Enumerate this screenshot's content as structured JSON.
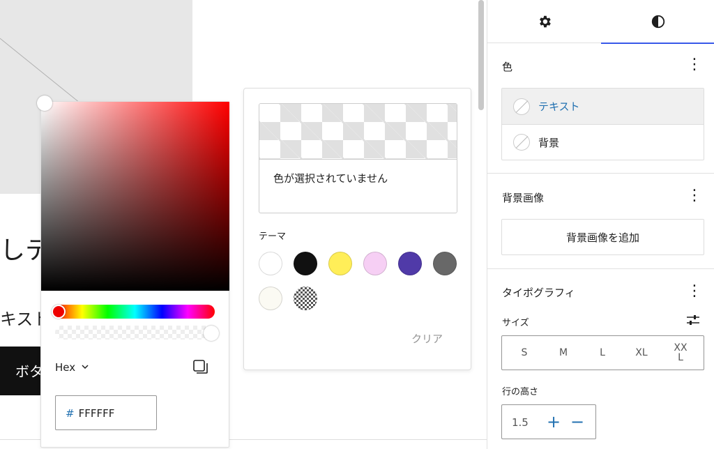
{
  "canvas": {
    "heading_fragment": "しテ",
    "text_fragment": "キスト",
    "button_fragment": "ボタ"
  },
  "color_picker": {
    "format_label": "Hex",
    "hex_prefix": "#",
    "hex_value": "FFFFFF",
    "icons": {
      "format_dropdown": "chevron-down-icon",
      "copy": "copy-icon"
    }
  },
  "swatch_popover": {
    "no_color_text": "色が選択されていません",
    "theme_label": "テーマ",
    "clear_label": "クリア",
    "swatches": [
      {
        "color": "#ffffff"
      },
      {
        "color": "#111111"
      },
      {
        "color": "#ffee58"
      },
      {
        "color": "#f6cfF4"
      },
      {
        "color": "#503aa8"
      },
      {
        "color": "#686868"
      },
      {
        "color": "#fbfaf3"
      },
      {
        "color": "transparent-pattern"
      }
    ]
  },
  "sidebar": {
    "tabs": [
      {
        "icon": "gear-icon",
        "active": false
      },
      {
        "icon": "contrast-icon",
        "active": true
      }
    ],
    "color_panel": {
      "title": "色",
      "items": [
        {
          "label": "テキスト",
          "selected": true
        },
        {
          "label": "背景",
          "selected": false
        }
      ]
    },
    "background_image_panel": {
      "title": "背景画像",
      "add_button": "背景画像を追加"
    },
    "typography_panel": {
      "title": "タイポグラフィ",
      "size_label": "サイズ",
      "sizes": [
        "S",
        "M",
        "L",
        "XL",
        "XX\nL"
      ],
      "line_height_label": "行の高さ",
      "line_height_value": "1.5",
      "plus": "+",
      "minus": "−"
    }
  },
  "colors": {
    "accent": "#3858e9",
    "link": "#2271b1"
  }
}
